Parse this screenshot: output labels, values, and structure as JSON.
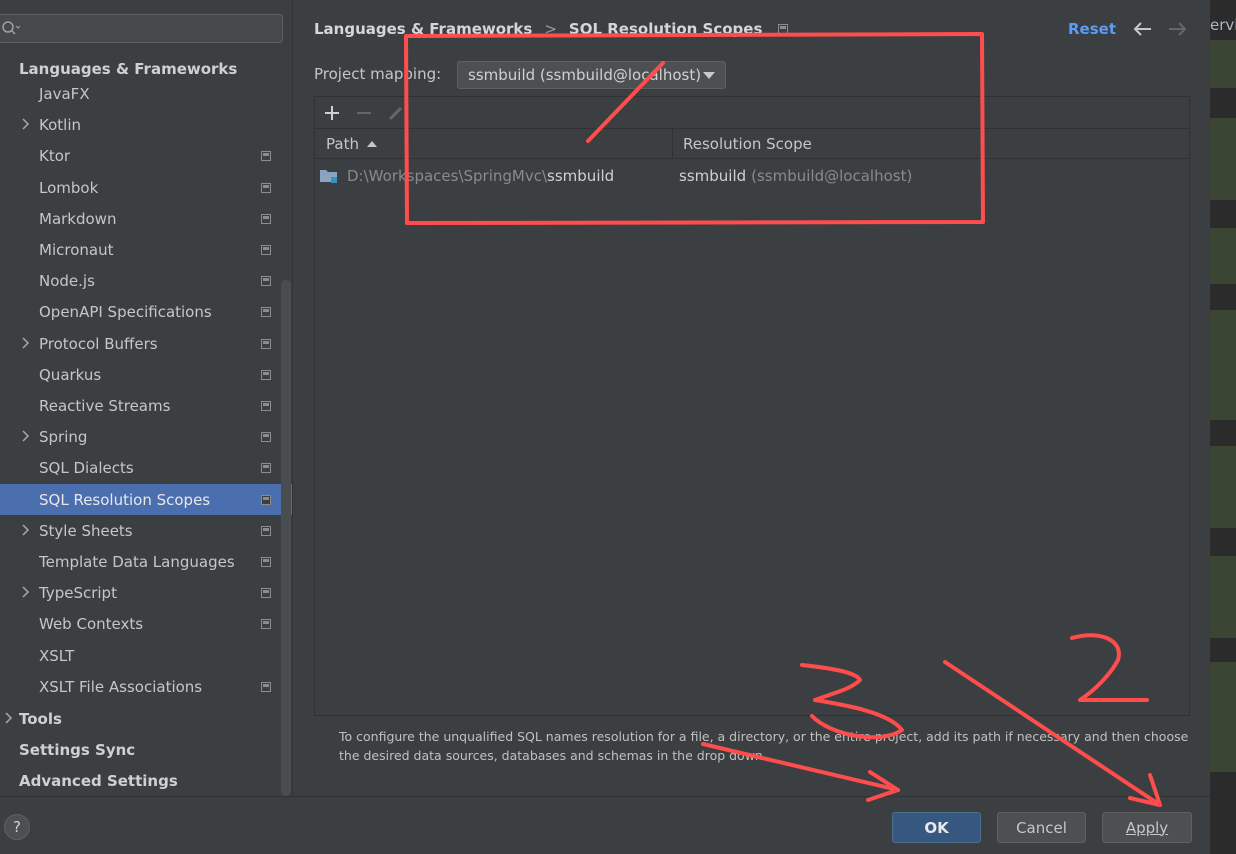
{
  "sidebar": {
    "search_placeholder": "",
    "group_header": "Languages & Frameworks",
    "items": [
      {
        "label": "JavaFX",
        "chevron": false,
        "proj_icon": false
      },
      {
        "label": "Kotlin",
        "chevron": true,
        "proj_icon": false
      },
      {
        "label": "Ktor",
        "chevron": false,
        "proj_icon": true
      },
      {
        "label": "Lombok",
        "chevron": false,
        "proj_icon": true
      },
      {
        "label": "Markdown",
        "chevron": false,
        "proj_icon": true
      },
      {
        "label": "Micronaut",
        "chevron": false,
        "proj_icon": true
      },
      {
        "label": "Node.js",
        "chevron": false,
        "proj_icon": true
      },
      {
        "label": "OpenAPI Specifications",
        "chevron": false,
        "proj_icon": true
      },
      {
        "label": "Protocol Buffers",
        "chevron": true,
        "proj_icon": true
      },
      {
        "label": "Quarkus",
        "chevron": false,
        "proj_icon": true
      },
      {
        "label": "Reactive Streams",
        "chevron": false,
        "proj_icon": true
      },
      {
        "label": "Spring",
        "chevron": true,
        "proj_icon": true
      },
      {
        "label": "SQL Dialects",
        "chevron": false,
        "proj_icon": true
      },
      {
        "label": "SQL Resolution Scopes",
        "chevron": false,
        "proj_icon": true,
        "selected": true
      },
      {
        "label": "Style Sheets",
        "chevron": true,
        "proj_icon": true
      },
      {
        "label": "Template Data Languages",
        "chevron": false,
        "proj_icon": true
      },
      {
        "label": "TypeScript",
        "chevron": true,
        "proj_icon": true
      },
      {
        "label": "Web Contexts",
        "chevron": false,
        "proj_icon": true
      },
      {
        "label": "XSLT",
        "chevron": false,
        "proj_icon": false
      },
      {
        "label": "XSLT File Associations",
        "chevron": false,
        "proj_icon": true
      }
    ],
    "top_level": [
      {
        "label": "Tools",
        "chevron": true
      },
      {
        "label": "Settings Sync",
        "chevron": false
      },
      {
        "label": "Advanced Settings",
        "chevron": false
      }
    ]
  },
  "header": {
    "breadcrumb_parent": "Languages & Frameworks",
    "breadcrumb_separator": ">",
    "breadcrumb_current": "SQL Resolution Scopes",
    "reset_label": "Reset"
  },
  "mapping": {
    "label": "Project mapping:",
    "selected": "ssmbuild (ssmbuild@localhost)"
  },
  "table": {
    "columns": [
      "Path",
      "Resolution Scope"
    ],
    "rows": [
      {
        "path_prefix": "D:\\Workspaces\\SpringMvc\\",
        "path_name": "ssmbuild",
        "scope_main": "ssmbuild",
        "scope_detail": "(ssmbuild@localhost)"
      }
    ]
  },
  "hint": "To configure the unqualified SQL names resolution for a file, a directory, or the entire project, add its path if necessary and then choose the desired data sources, databases and schemas in the drop down.",
  "footer": {
    "help_label": "?",
    "ok_label": "OK",
    "cancel_label": "Cancel",
    "apply_label": "Apply"
  },
  "background_editor": {
    "visible_text": "ervi"
  },
  "colors": {
    "accent": "#4b6eaf",
    "link": "#589df6",
    "annotation": "#ff4d4d",
    "panel_bg": "#3c3f41"
  }
}
